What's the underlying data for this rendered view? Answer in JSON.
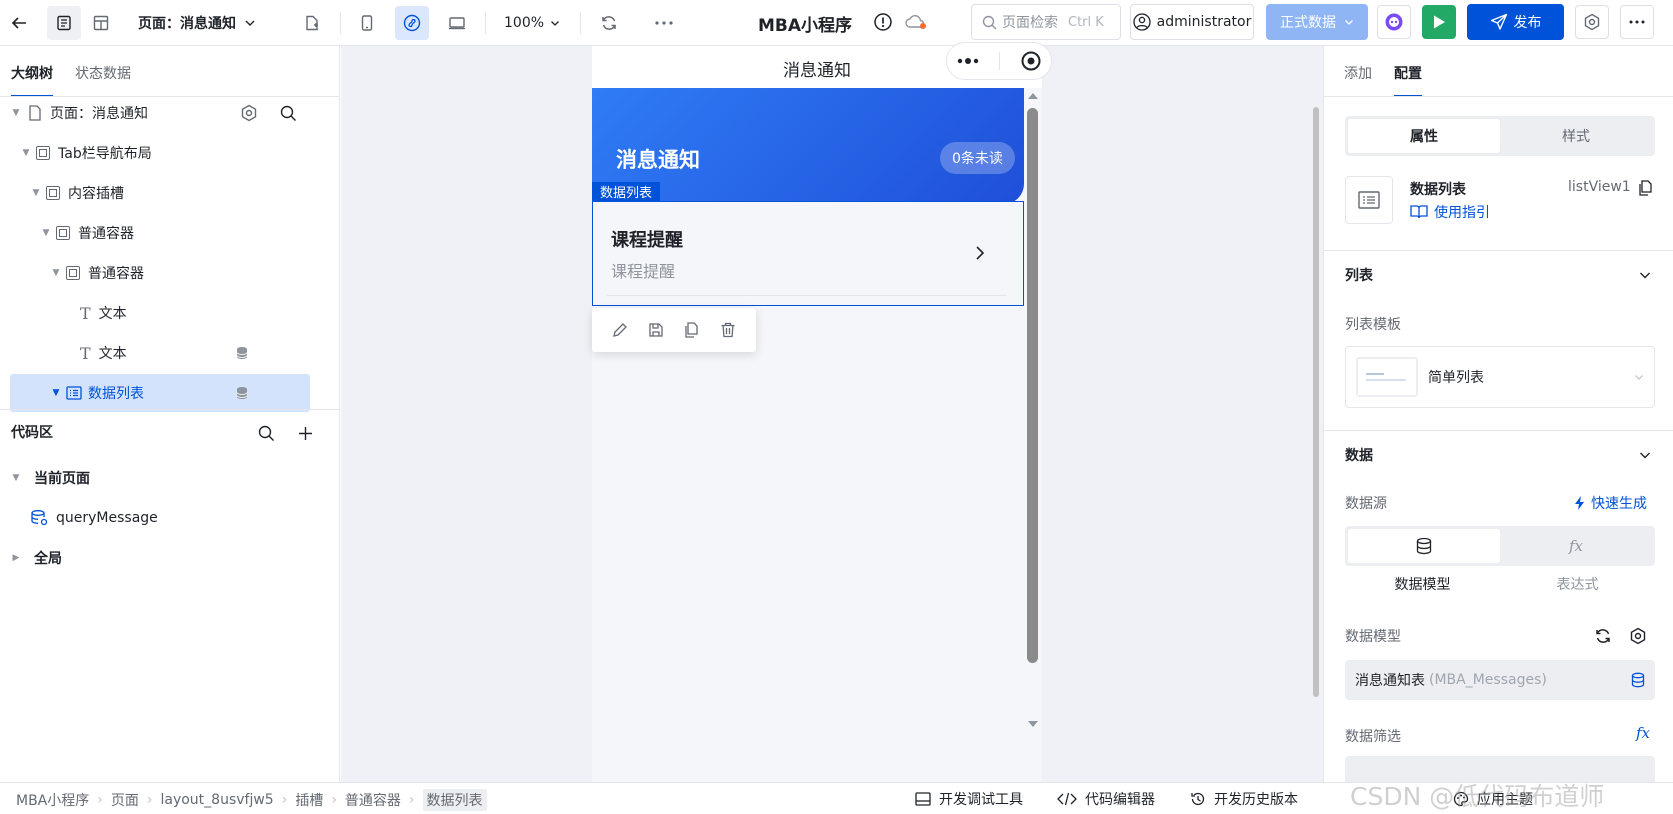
{
  "topbar": {
    "page_label": "页面：消息通知",
    "zoom": "100%",
    "app_title": "MBA小程序",
    "search_placeholder": "页面检索",
    "search_shortcut": "Ctrl K",
    "user": "administrator",
    "env": "正式数据",
    "publish": "发布"
  },
  "left": {
    "tabs": [
      "大纲树",
      "状态数据"
    ],
    "tree": [
      {
        "label": "页面：消息通知"
      },
      {
        "label": "Tab栏导航布局"
      },
      {
        "label": "内容插槽"
      },
      {
        "label": "普通容器"
      },
      {
        "label": "普通容器"
      },
      {
        "label": "文本"
      },
      {
        "label": "文本"
      },
      {
        "label": "数据列表"
      }
    ],
    "code_title": "代码区",
    "current_page": "当前页面",
    "query": "queryMessage",
    "global": "全局"
  },
  "phone": {
    "nav_title": "消息通知",
    "header_title": "消息通知",
    "unread_badge": "0条未读",
    "selected_tag": "数据列表",
    "item_title": "课程提醒",
    "item_sub": "课程提醒"
  },
  "right": {
    "tabs": [
      "添加",
      "配置"
    ],
    "seg": [
      "属性",
      "样式"
    ],
    "comp_name": "数据列表",
    "comp_id": "listView1",
    "guide": "使用指引",
    "list_section": "列表",
    "template_label": "列表模板",
    "template_value": "简单列表",
    "data_section": "数据",
    "datasource_label": "数据源",
    "quick_gen": "快速生成",
    "ds_options": [
      "数据模型",
      "表达式"
    ],
    "model_label": "数据模型",
    "model_value": "消息通知表",
    "model_code": "(MBA_Messages)",
    "filter_label": "数据筛选"
  },
  "footer": {
    "breadcrumb": [
      "MBA小程序",
      "页面",
      "layout_8usvfjw5",
      "插槽",
      "普通容器",
      "数据列表"
    ],
    "tools": [
      "开发调试工具",
      "代码编辑器",
      "开发历史版本",
      "应用主题"
    ],
    "watermark": "CSDN @低代码布道师"
  },
  "colors": {
    "primary": "#0052d9",
    "header_blue": "#2d6ee8",
    "env": "#8fb5f4"
  }
}
